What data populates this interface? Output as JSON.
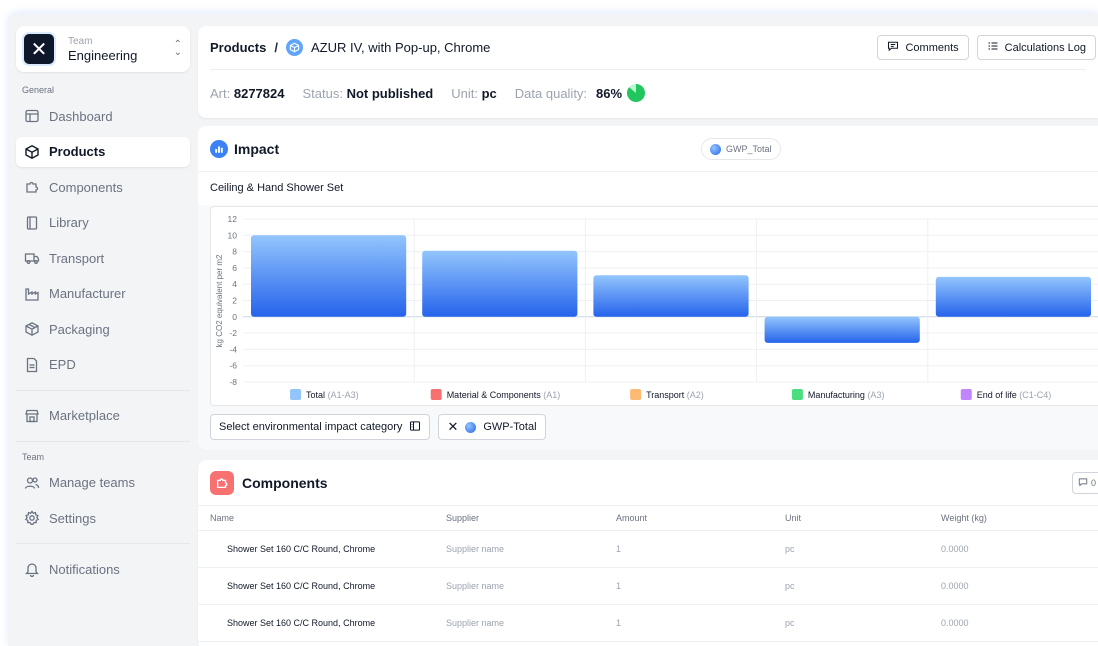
{
  "team": {
    "label": "Team",
    "name": "Engineering"
  },
  "sidebar": {
    "section_general": "General",
    "section_team": "Team",
    "items": [
      {
        "label": "Dashboard",
        "icon": "layout-icon"
      },
      {
        "label": "Products",
        "icon": "cube-icon"
      },
      {
        "label": "Components",
        "icon": "puzzle-icon"
      },
      {
        "label": "Library",
        "icon": "book-icon"
      },
      {
        "label": "Transport",
        "icon": "truck-icon"
      },
      {
        "label": "Manufacturer",
        "icon": "factory-icon"
      },
      {
        "label": "Packaging",
        "icon": "package-icon"
      },
      {
        "label": "EPD",
        "icon": "document-icon"
      }
    ],
    "marketplace": "Marketplace",
    "team_items": [
      {
        "label": "Manage teams",
        "icon": "users-icon"
      },
      {
        "label": "Settings",
        "icon": "gear-icon"
      }
    ],
    "notifications": "Notifications"
  },
  "header": {
    "breadcrumb_root": "Products",
    "breadcrumb_sep": "/",
    "product_name": "AZUR IV, with Pop-up, Chrome",
    "comments_label": "Comments",
    "calc_log_label": "Calculations Log",
    "art_label": "Art:",
    "art_value": "8277824",
    "status_label": "Status:",
    "status_value": "Not published",
    "unit_label": "Unit:",
    "unit_value": "pc",
    "quality_label": "Data quality:",
    "quality_value": "86%",
    "quality_fraction": 0.86
  },
  "impact": {
    "title": "Impact",
    "pill_label": "GWP_Total",
    "chart_subtitle": "Ceiling & Hand Shower Set",
    "select_label": "Select environmental impact category",
    "active_filter": "GWP-Total"
  },
  "chart_data": {
    "type": "bar",
    "title": "Ceiling & Hand Shower Set",
    "ylabel": "kg CO2 equivalent per m2",
    "ylim": [
      -8,
      12
    ],
    "yticks": [
      12,
      10,
      8,
      6,
      4,
      2,
      0,
      -2,
      -4,
      -6,
      -8
    ],
    "grid": true,
    "values": [
      10,
      8.1,
      5.1,
      -3.2,
      4.9
    ],
    "legend": [
      {
        "name": "Total",
        "code": "(A1-A3)",
        "color": "#93c5fd"
      },
      {
        "name": "Material & Components",
        "code": "(A1)",
        "color": "#f87171"
      },
      {
        "name": "Transport",
        "code": "(A2)",
        "color": "#fdba74"
      },
      {
        "name": "Manufacturing",
        "code": "(A3)",
        "color": "#4ade80"
      },
      {
        "name": "End of life",
        "code": "(C1-C4)",
        "color": "#c084fc"
      }
    ]
  },
  "components": {
    "title": "Components",
    "comment_count": "0",
    "columns": [
      "Name",
      "Supplier",
      "Amount",
      "Unit",
      "Weight (kg)"
    ],
    "rows": [
      [
        "Shower Set 160 C/C Round, Chrome",
        "Supplier name",
        "1",
        "pc",
        "0.0000"
      ],
      [
        "Shower Set 160 C/C Round, Chrome",
        "Supplier name",
        "1",
        "pc",
        "0.0000"
      ],
      [
        "Shower Set 160 C/C Round, Chrome",
        "Supplier name",
        "1",
        "pc",
        "0.0000"
      ]
    ]
  }
}
